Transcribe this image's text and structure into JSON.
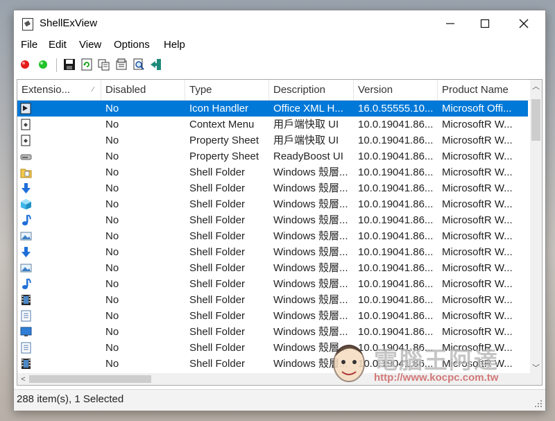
{
  "window": {
    "title": "ShellExView"
  },
  "menu": [
    "File",
    "Edit",
    "View",
    "Options",
    "Help"
  ],
  "toolbar": {
    "icons": [
      "red-dot-icon",
      "green-dot-icon",
      "save-icon",
      "refresh-icon",
      "copy-icon",
      "properties-icon",
      "find-icon",
      "exit-icon"
    ]
  },
  "columns": [
    {
      "label": "Extensio...",
      "sorted": true
    },
    {
      "label": "Disabled"
    },
    {
      "label": "Type"
    },
    {
      "label": "Description"
    },
    {
      "label": "Version"
    },
    {
      "label": "Product Name"
    }
  ],
  "rows": [
    {
      "icon": "arrow-file-icon",
      "disabled": "No",
      "type": "Icon Handler",
      "description": "Office XML H...",
      "version": "16.0.55555.10...",
      "product": "Microsoft Offi...",
      "selected": true
    },
    {
      "icon": "document-icon",
      "disabled": "No",
      "type": "Context Menu",
      "description": "用戶端快取 UI",
      "version": "10.0.19041.86...",
      "product": "MicrosoftR W..."
    },
    {
      "icon": "document-icon",
      "disabled": "No",
      "type": "Property Sheet",
      "description": "用戶端快取 UI",
      "version": "10.0.19041.86...",
      "product": "MicrosoftR W..."
    },
    {
      "icon": "drive-icon",
      "disabled": "No",
      "type": "Property Sheet",
      "description": "ReadyBoost UI",
      "version": "10.0.19041.86...",
      "product": "MicrosoftR W..."
    },
    {
      "icon": "folder-icon",
      "disabled": "No",
      "type": "Shell Folder",
      "description": "Windows 殼層...",
      "version": "10.0.19041.86...",
      "product": "MicrosoftR W..."
    },
    {
      "icon": "download-icon",
      "disabled": "No",
      "type": "Shell Folder",
      "description": "Windows 殼層...",
      "version": "10.0.19041.86...",
      "product": "MicrosoftR W..."
    },
    {
      "icon": "cube-icon",
      "disabled": "No",
      "type": "Shell Folder",
      "description": "Windows 殼層...",
      "version": "10.0.19041.86...",
      "product": "MicrosoftR W..."
    },
    {
      "icon": "music-icon",
      "disabled": "No",
      "type": "Shell Folder",
      "description": "Windows 殼層...",
      "version": "10.0.19041.86...",
      "product": "MicrosoftR W..."
    },
    {
      "icon": "picture-icon",
      "disabled": "No",
      "type": "Shell Folder",
      "description": "Windows 殼層...",
      "version": "10.0.19041.86...",
      "product": "MicrosoftR W..."
    },
    {
      "icon": "download-icon",
      "disabled": "No",
      "type": "Shell Folder",
      "description": "Windows 殼層...",
      "version": "10.0.19041.86...",
      "product": "MicrosoftR W..."
    },
    {
      "icon": "picture-icon",
      "disabled": "No",
      "type": "Shell Folder",
      "description": "Windows 殼層...",
      "version": "10.0.19041.86...",
      "product": "MicrosoftR W..."
    },
    {
      "icon": "music-icon",
      "disabled": "No",
      "type": "Shell Folder",
      "description": "Windows 殼層...",
      "version": "10.0.19041.86...",
      "product": "MicrosoftR W..."
    },
    {
      "icon": "video-icon",
      "disabled": "No",
      "type": "Shell Folder",
      "description": "Windows 殼層...",
      "version": "10.0.19041.86...",
      "product": "MicrosoftR W..."
    },
    {
      "icon": "document-lines-icon",
      "disabled": "No",
      "type": "Shell Folder",
      "description": "Windows 殼層...",
      "version": "10.0.19041.86...",
      "product": "MicrosoftR W..."
    },
    {
      "icon": "desktop-icon",
      "disabled": "No",
      "type": "Shell Folder",
      "description": "Windows 殼層...",
      "version": "10.0.19041.86...",
      "product": "MicrosoftR W..."
    },
    {
      "icon": "document-lines-icon",
      "disabled": "No",
      "type": "Shell Folder",
      "description": "Windows 殼層...",
      "version": "10.0.19041.86...",
      "product": "MicrosoftR W..."
    },
    {
      "icon": "video-icon",
      "disabled": "No",
      "type": "Shell Folder",
      "description": "Windows 殼層...",
      "version": "10.0.19041.86...",
      "product": "MicrosoftR W..."
    }
  ],
  "status": {
    "text": "288 item(s), 1 Selected"
  },
  "watermark": {
    "title": "電腦王阿達",
    "url": "http://www.kocpc.com.tw"
  },
  "colors": {
    "selection": "#0078d7"
  }
}
